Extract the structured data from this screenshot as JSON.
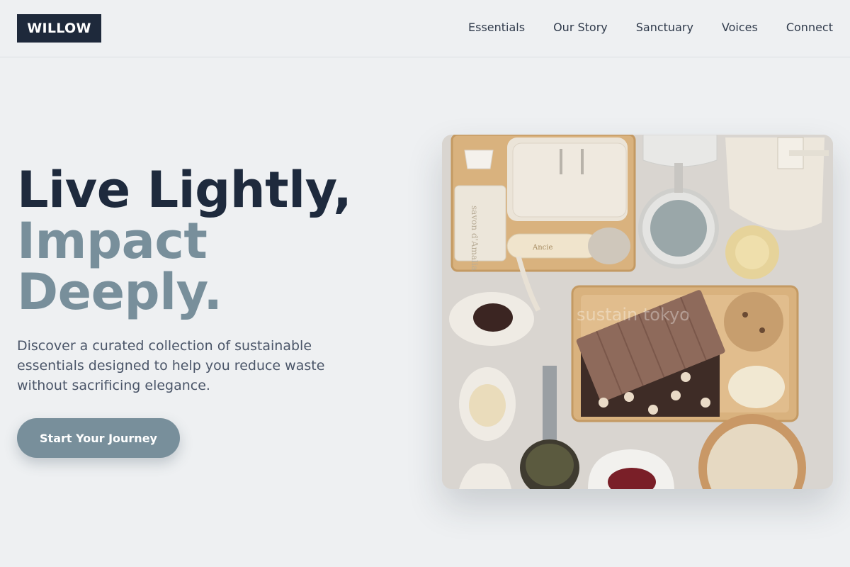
{
  "header": {
    "logo": "WILLOW",
    "nav": [
      "Essentials",
      "Our Story",
      "Sanctuary",
      "Voices",
      "Connect"
    ]
  },
  "hero": {
    "title_line1": "Live Lightly,",
    "title_line2": "Impact",
    "title_line3": "Deeply.",
    "subtitle": "Discover a curated collection of sustainable essentials designed to help you reduce waste without sacrificing elegance.",
    "cta": "Start Your Journey"
  },
  "image": {
    "watermark": "sustain tokyo",
    "soap_stamp": "savon d'Amalia",
    "brush_stamp": "Ancie"
  },
  "colors": {
    "primary_dark": "#1e293b",
    "accent": "#788f9b",
    "background": "#eef0f2"
  }
}
